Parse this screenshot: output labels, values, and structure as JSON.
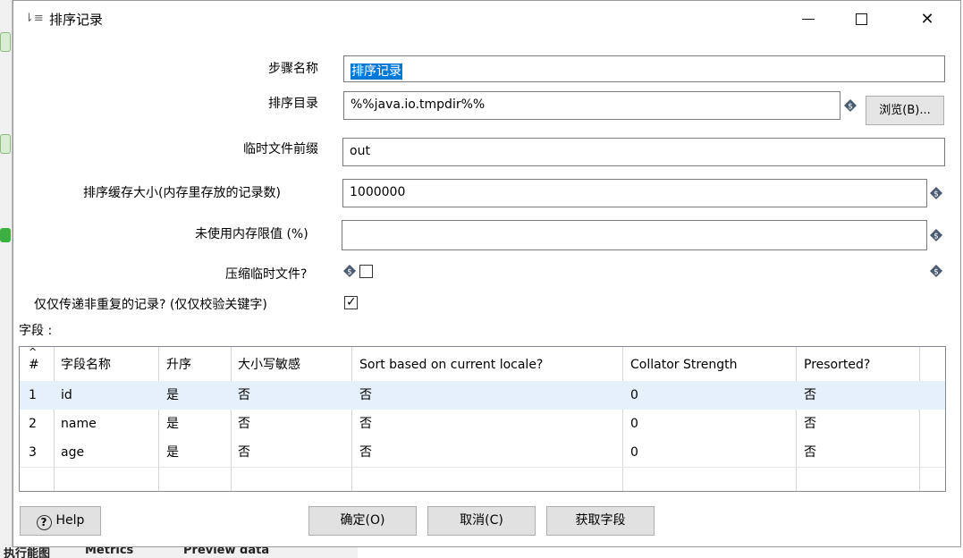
{
  "window": {
    "title": "排序记录",
    "title_icon": "sort-icon",
    "controls": {
      "minimize": "—",
      "maximize": "☐",
      "close": "✕"
    }
  },
  "form": {
    "step_name": {
      "label": "步骤名称",
      "value": "排序记录"
    },
    "sort_dir": {
      "label": "排序目录",
      "value": "%%java.io.tmpdir%%",
      "browse_label": "浏览(B)..."
    },
    "temp_prefix": {
      "label": "临时文件前缀",
      "value": "out"
    },
    "sort_buffer": {
      "label": "排序缓存大小(内存里存放的记录数)",
      "value": "1000000"
    },
    "free_memory": {
      "label": "未使用内存限值 (%)",
      "value": ""
    },
    "compress": {
      "label": "压缩临时文件?",
      "checked": false
    },
    "unique_rows": {
      "label": "仅仅传递非重复的记录? (仅仅校验关键字)",
      "checked": true
    }
  },
  "fields_label": "字段 :",
  "table": {
    "sort_icon": "^",
    "columns": [
      "#",
      "字段名称",
      "升序",
      "大小写敏感",
      "Sort based on current locale?",
      "Collator Strength",
      "Presorted?"
    ],
    "rows": [
      {
        "num": "1",
        "name": "id",
        "asc": "是",
        "case": "否",
        "locale": "否",
        "strength": "0",
        "presorted": "否",
        "selected": true
      },
      {
        "num": "2",
        "name": "name",
        "asc": "是",
        "case": "否",
        "locale": "否",
        "strength": "0",
        "presorted": "否",
        "selected": false
      },
      {
        "num": "3",
        "name": "age",
        "asc": "是",
        "case": "否",
        "locale": "否",
        "strength": "0",
        "presorted": "否",
        "selected": false
      }
    ]
  },
  "buttons": {
    "help": "Help",
    "ok": "确定(O)",
    "cancel": "取消(C)",
    "get_fields": "获取字段"
  },
  "background": {
    "tabs": [
      "执行能图",
      "Metrics",
      "Preview data"
    ]
  },
  "colors": {
    "selection": "#0078d7",
    "row_highlight": "#e5f0fb",
    "variable_icon": "#4a5a70"
  }
}
